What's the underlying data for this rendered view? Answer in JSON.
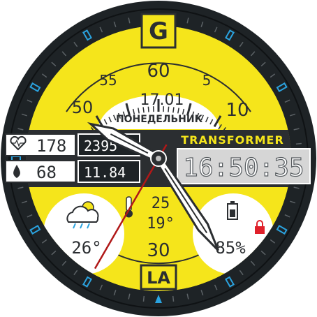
{
  "watch_face": {
    "brand_letter": "G",
    "brand_bottom": "LA",
    "colors": {
      "accent": "#f5e51b",
      "bezel": "#1e2326",
      "bezel_mark": "#2aa3e0",
      "dark_panel": "#2b2e31",
      "lcd_bg": "#d6d6d6",
      "lock": "#e0202a",
      "second_hand": "#b01818"
    },
    "dial_numbers": {
      "top": "60",
      "left_upper": "55",
      "right_upper": "5",
      "left_mid": "50",
      "right_mid": "10",
      "bottom": "30"
    },
    "date": "17.01",
    "weekday": "ПОНЕДЕЛЬНИК",
    "model_label": "TRANSFORMER",
    "heart_rate": "178",
    "humidity": "68",
    "steps": "2395",
    "distance": "11.84",
    "time": "16:50:35",
    "weather": {
      "icon": "partly-cloudy-rain-icon",
      "temperature": "26°"
    },
    "indoor": {
      "icon": "thermometer-icon",
      "upper": "25",
      "lower": "19°"
    },
    "battery": {
      "icon": "battery-icon",
      "percent": "85%"
    },
    "lock_icon": "lock-icon",
    "hands": {
      "hour_angle_deg": 297,
      "minute_angle_deg": 147,
      "second_angle_deg": 210
    }
  }
}
